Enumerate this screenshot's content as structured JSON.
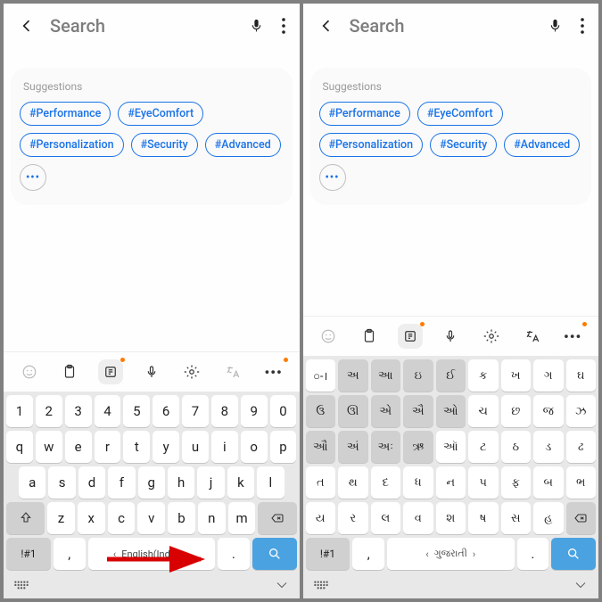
{
  "common": {
    "search_placeholder": "Search",
    "suggestions_title": "Suggestions",
    "chips": [
      "#Performance",
      "#EyeComfort",
      "#Personalization",
      "#Security",
      "#Advanced"
    ],
    "more_dots": "•••"
  },
  "left": {
    "language_label": "English(India)",
    "num_row": [
      "1",
      "2",
      "3",
      "4",
      "5",
      "6",
      "7",
      "8",
      "9",
      "0"
    ],
    "row1": [
      "q",
      "w",
      "e",
      "r",
      "t",
      "y",
      "u",
      "i",
      "o",
      "p"
    ],
    "row2": [
      "a",
      "s",
      "d",
      "f",
      "g",
      "h",
      "j",
      "k",
      "l"
    ],
    "row3": [
      "z",
      "x",
      "c",
      "v",
      "b",
      "n",
      "m"
    ],
    "sym_key": "!#1",
    "comma": ",",
    "period": "."
  },
  "right": {
    "language_label": "ગુજરાતી",
    "row1": [
      "○-।",
      "અ",
      "આ",
      "ઇ",
      "ઈ",
      "ક",
      "ખ",
      "ગ",
      "ઘ"
    ],
    "row1_vowel": [
      false,
      true,
      true,
      true,
      true,
      false,
      false,
      false,
      false
    ],
    "row2": [
      "ઉ",
      "ઊ",
      "એ",
      "ઐ",
      "ઓ",
      "ચ",
      "છ",
      "જ",
      "ઝ"
    ],
    "row2_vowel": [
      true,
      true,
      true,
      true,
      true,
      false,
      false,
      false,
      false
    ],
    "row3": [
      "ઔ",
      "અં",
      "અઃ",
      "ઋ",
      "ઑ",
      "ટ",
      "ઠ",
      "ડ",
      "ઢ"
    ],
    "row3_vowel": [
      true,
      true,
      true,
      true,
      false,
      false,
      false,
      false,
      false
    ],
    "row4": [
      "ત",
      "થ",
      "દ",
      "ધ",
      "ન",
      "પ",
      "ફ",
      "બ",
      "ભ"
    ],
    "row5": [
      "ય",
      "ર",
      "લ",
      "વ",
      "શ",
      "ષ",
      "સ",
      "હ"
    ],
    "sym_key": "!#1",
    "comma": ",",
    "period": "."
  }
}
